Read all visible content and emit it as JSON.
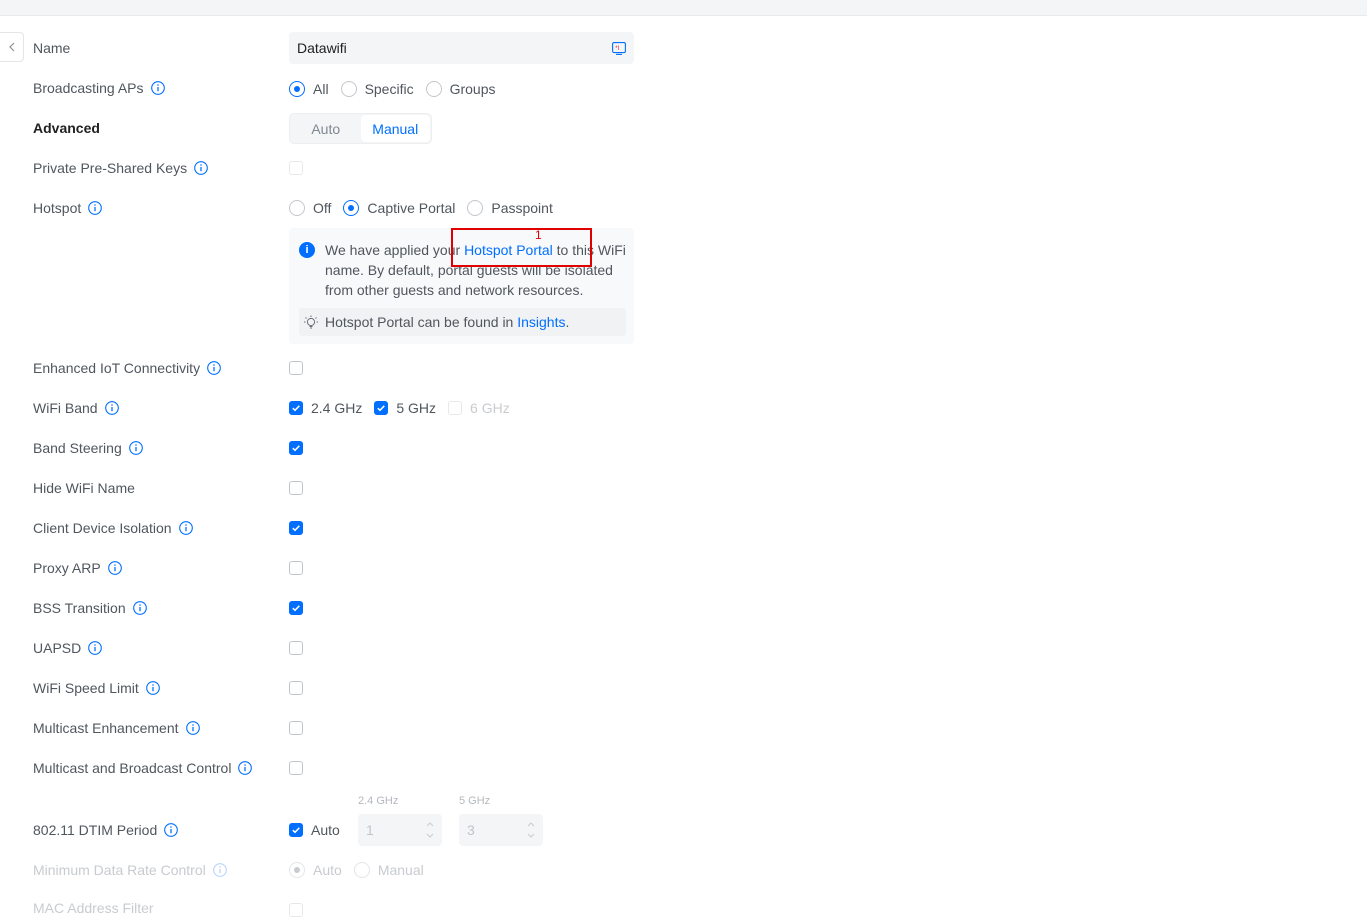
{
  "colors": {
    "accent": "#006fff",
    "annotation": "#e00000",
    "text": "#50565e",
    "disabled": "#c8cbcf"
  },
  "name": {
    "label": "Name",
    "value": "Datawifi",
    "icon": "keyboard-icon"
  },
  "broadcasting_aps": {
    "label": "Broadcasting APs",
    "options": [
      "All",
      "Specific",
      "Groups"
    ],
    "selected": "All"
  },
  "advanced": {
    "label": "Advanced",
    "options": [
      "Auto",
      "Manual"
    ],
    "selected": "Manual"
  },
  "ppsk": {
    "label": "Private Pre-Shared Keys"
  },
  "hotspot": {
    "label": "Hotspot",
    "options": [
      "Off",
      "Captive Portal",
      "Passpoint"
    ],
    "selected": "Captive Portal",
    "notice_before": "We have applied your ",
    "notice_link": "Hotspot Portal",
    "notice_after": " to this WiFi name. By default, portal guests will be isolated from other guests and network resources.",
    "tip_before": "Hotspot Portal can be found in ",
    "tip_link": "Insights",
    "tip_after": "."
  },
  "annotation": {
    "number": "1"
  },
  "settings": [
    {
      "label": "Enhanced IoT Connectivity",
      "checked": false
    },
    {
      "label": "WiFi Band"
    },
    {
      "label": "Band Steering",
      "checked": true
    },
    {
      "label": "Hide WiFi Name",
      "checked": false
    },
    {
      "label": "Client Device Isolation",
      "checked": true
    },
    {
      "label": "Proxy ARP",
      "checked": false
    },
    {
      "label": "BSS Transition",
      "checked": true
    },
    {
      "label": "UAPSD",
      "checked": false
    },
    {
      "label": "WiFi Speed Limit",
      "checked": false
    },
    {
      "label": "Multicast Enhancement",
      "checked": false
    },
    {
      "label": "Multicast and Broadcast Control",
      "checked": false
    }
  ],
  "wifi_band": {
    "b24": "2.4 GHz",
    "b5": "5 GHz",
    "b6": "6 GHz",
    "b24_checked": true,
    "b5_checked": true,
    "b6_checked": false
  },
  "dtim": {
    "label": "802.11 DTIM Period",
    "auto_label": "Auto",
    "auto_checked": true,
    "col24": "2.4 GHz",
    "col5": "5 GHz",
    "value24": "1",
    "value5": "3"
  },
  "min_rate": {
    "label": "Minimum Data Rate Control",
    "options": [
      "Auto",
      "Manual"
    ],
    "selected": "Auto"
  },
  "mac_filter": {
    "label": "MAC Address Filter"
  }
}
